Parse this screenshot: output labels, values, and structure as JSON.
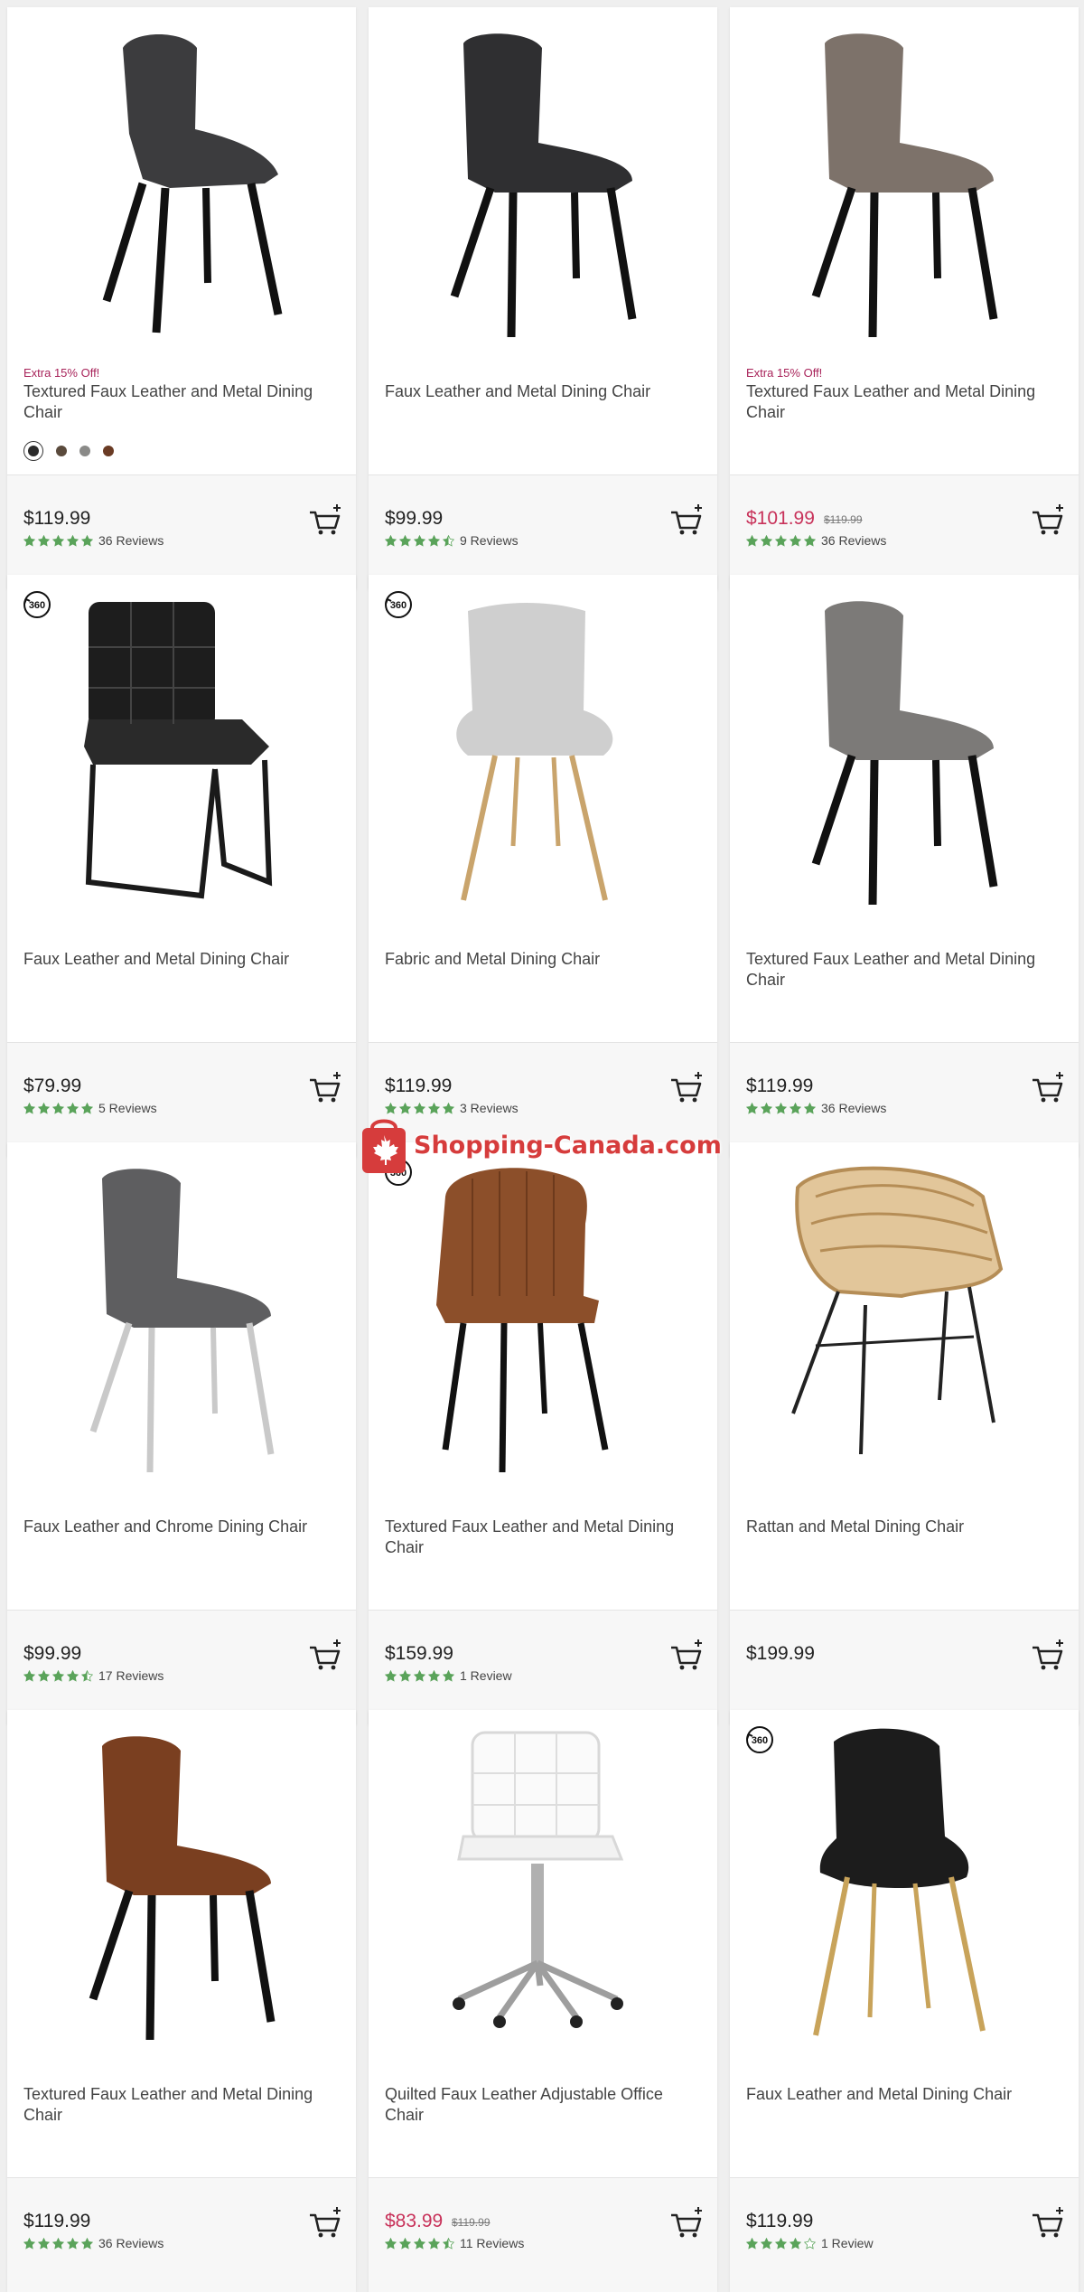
{
  "watermark": {
    "text": "Shopping-Canada.com"
  },
  "colors": {
    "star": "#5aa35a",
    "sale": "#c8325a",
    "promo": "#a8235a"
  },
  "products": [
    {
      "promo": "Extra 15% Off!",
      "title": "Textured Faux Leather and Metal Dining Chair",
      "price": "$119.99",
      "old_price": "",
      "rating": 5,
      "reviews": "36 Reviews",
      "badge360": false,
      "swatches": [
        "#2a2a2a",
        "#5a4a3c",
        "#8a8a88",
        "#6a3b24"
      ]
    },
    {
      "promo": "",
      "title": "Faux Leather and Metal Dining Chair",
      "price": "$99.99",
      "old_price": "",
      "rating": 4.5,
      "reviews": "9 Reviews",
      "badge360": false,
      "swatches": []
    },
    {
      "promo": "Extra 15% Off!",
      "title": "Textured Faux Leather and Metal Dining Chair",
      "price": "$101.99",
      "old_price": "$119.99",
      "rating": 5,
      "reviews": "36 Reviews",
      "badge360": false,
      "swatches": []
    },
    {
      "promo": "",
      "title": "Faux Leather and Metal Dining Chair",
      "price": "$79.99",
      "old_price": "",
      "rating": 5,
      "reviews": "5 Reviews",
      "badge360": true,
      "swatches": []
    },
    {
      "promo": "",
      "title": "Fabric and Metal Dining Chair",
      "price": "$119.99",
      "old_price": "",
      "rating": 5,
      "reviews": "3 Reviews",
      "badge360": true,
      "swatches": []
    },
    {
      "promo": "",
      "title": "Textured Faux Leather and Metal Dining Chair",
      "price": "$119.99",
      "old_price": "",
      "rating": 5,
      "reviews": "36 Reviews",
      "badge360": false,
      "swatches": []
    },
    {
      "promo": "",
      "title": "Faux Leather and Chrome Dining Chair",
      "price": "$99.99",
      "old_price": "",
      "rating": 4.5,
      "reviews": "17 Reviews",
      "badge360": false,
      "swatches": []
    },
    {
      "promo": "",
      "title": "Textured Faux Leather and Metal Dining Chair",
      "price": "$159.99",
      "old_price": "",
      "rating": 5,
      "reviews": "1 Review",
      "badge360": true,
      "swatches": []
    },
    {
      "promo": "",
      "title": "Rattan and Metal Dining Chair",
      "price": "$199.99",
      "old_price": "",
      "rating": 0,
      "reviews": "",
      "badge360": false,
      "swatches": []
    },
    {
      "promo": "",
      "title": "Textured Faux Leather and Metal Dining Chair",
      "price": "$119.99",
      "old_price": "",
      "rating": 5,
      "reviews": "36 Reviews",
      "badge360": false,
      "swatches": []
    },
    {
      "promo": "",
      "title": "Quilted Faux Leather Adjustable Office Chair",
      "price": "$83.99",
      "old_price": "$119.99",
      "rating": 4.5,
      "reviews": "11 Reviews",
      "badge360": false,
      "swatches": []
    },
    {
      "promo": "",
      "title": "Faux Leather and Metal Dining Chair",
      "price": "$119.99",
      "old_price": "",
      "rating": 4,
      "reviews": "1 Review",
      "badge360": true,
      "swatches": []
    }
  ]
}
